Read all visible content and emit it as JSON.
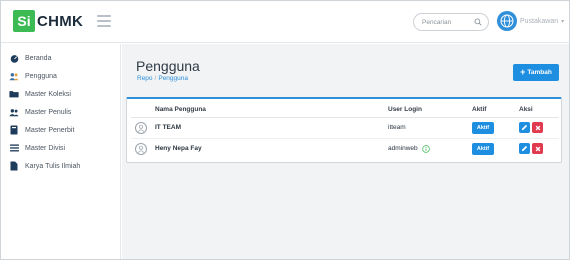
{
  "brand": {
    "si": "Si",
    "rest": "CHMK",
    "green": "#3cba54"
  },
  "header": {
    "search_placeholder": "Pencarian",
    "user_name": "Pustakawan",
    "caret": "▾"
  },
  "sidebar": {
    "items": [
      {
        "label": "Beranda",
        "icon": "dashboard-icon"
      },
      {
        "label": "Pengguna",
        "icon": "users-icon"
      },
      {
        "label": "Master Koleksi",
        "icon": "folder-icon"
      },
      {
        "label": "Master Penulis",
        "icon": "authors-icon"
      },
      {
        "label": "Master Penerbit",
        "icon": "book-icon"
      },
      {
        "label": "Master Divisi",
        "icon": "list-icon"
      },
      {
        "label": "Karya Tulis Ilmiah",
        "icon": "document-icon"
      }
    ]
  },
  "main": {
    "title": "Pengguna",
    "breadcrumb": {
      "root": "Repo",
      "sep": "/",
      "current": "Pengguna"
    },
    "add_button": {
      "icon": "+",
      "label": "Tambah"
    },
    "table": {
      "headers": [
        "",
        "Nama Pengguna",
        "User Login",
        "Aktif",
        "Aksi"
      ],
      "rows": [
        {
          "name": "IT TEAM",
          "login": "itteam",
          "status": "Aktif",
          "has_info": false
        },
        {
          "name": "Heny Nepa Fay",
          "login": "adminweb",
          "status": "Aktif",
          "has_info": true
        }
      ]
    }
  },
  "colors": {
    "accent": "#1e8ee0",
    "danger": "#e03a4e",
    "info_green": "#3cba54"
  }
}
